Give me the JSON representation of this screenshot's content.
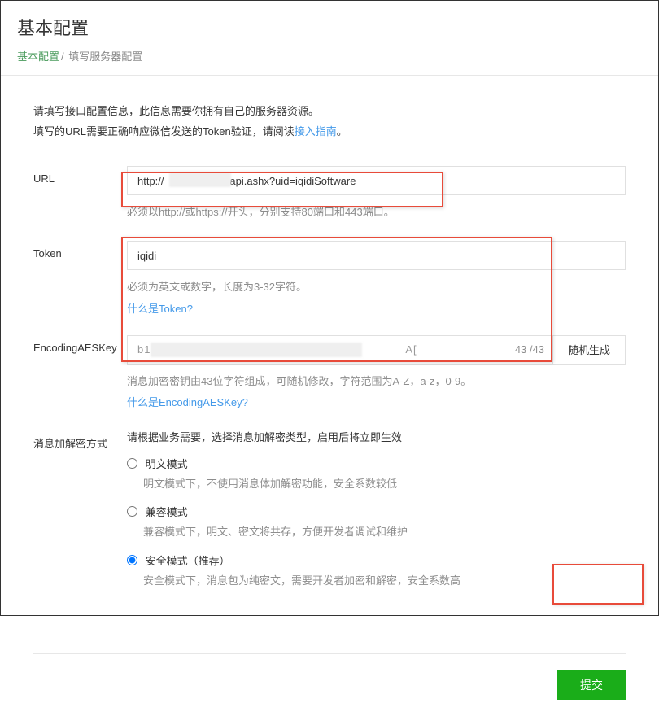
{
  "page_title": "基本配置",
  "breadcrumb": {
    "root": "基本配置",
    "separator": "/",
    "current": "填写服务器配置"
  },
  "intro": {
    "line1": "请填写接口配置信息，此信息需要你拥有自己的服务器资源。",
    "line2_prefix": "填写的URL需要正确响应微信发送的Token验证，请阅读",
    "line2_link": "接入指南",
    "line2_suffix": "。"
  },
  "fields": {
    "url": {
      "label": "URL",
      "value": "http://            om/wxapi.ashx?uid=iqidiSoftware",
      "hint": "必须以http://或https://开头，分别支持80端口和443端口。"
    },
    "token": {
      "label": "Token",
      "value": "iqidi",
      "hint": "必须为英文或数字，长度为3-32字符。",
      "help_link": "什么是Token?"
    },
    "aes": {
      "label": "EncodingAESKey",
      "value": "b1                                                                    A[",
      "counter": "43 /43",
      "random_btn": "随机生成",
      "hint": "消息加密密钥由43位字符组成，可随机修改，字符范围为A-Z，a-z，0-9。",
      "help_link": "什么是EncodingAESKey?"
    },
    "encrypt": {
      "label": "消息加解密方式",
      "intro": "请根据业务需要，选择消息加解密类型，启用后将立即生效",
      "options": [
        {
          "label": "明文模式",
          "desc": "明文模式下，不使用消息体加解密功能，安全系数较低",
          "checked": false
        },
        {
          "label": "兼容模式",
          "desc": "兼容模式下，明文、密文将共存，方便开发者调试和维护",
          "checked": false
        },
        {
          "label": "安全模式（推荐）",
          "desc": "安全模式下，消息包为纯密文，需要开发者加密和解密，安全系数高",
          "checked": true
        }
      ]
    }
  },
  "submit_label": "提交"
}
